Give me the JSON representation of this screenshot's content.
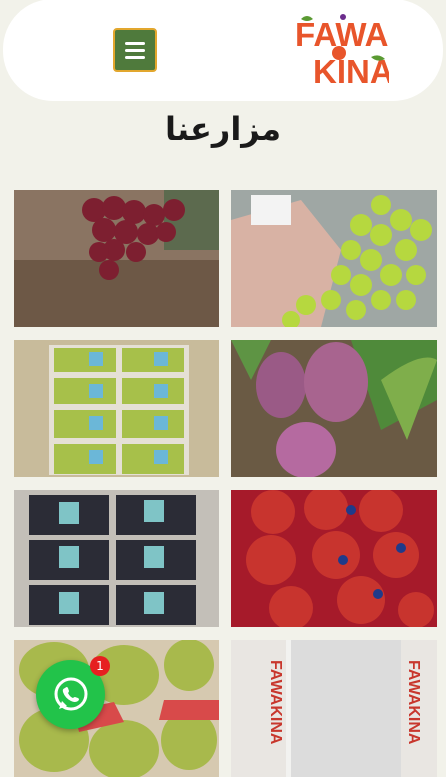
{
  "header": {
    "logo_text_line1": "FAWA",
    "logo_text_line2": "KINA",
    "menu_icon": "hamburger-menu-icon"
  },
  "page": {
    "title": "مزارعنا"
  },
  "gallery": {
    "items": [
      {
        "subject": "red-grapes"
      },
      {
        "subject": "green-grapes-in-hand"
      },
      {
        "subject": "packed-green-grapes"
      },
      {
        "subject": "mangoes-on-tree"
      },
      {
        "subject": "packed-black-grapes"
      },
      {
        "subject": "pomegranates-in-box"
      },
      {
        "subject": "mangoes-in-box"
      },
      {
        "subject": "fawakina-boxes"
      }
    ],
    "box_brand": "FAWAKINA"
  },
  "whatsapp": {
    "icon": "whatsapp-icon",
    "badge_count": "1"
  },
  "colors": {
    "background": "#f2f2ea",
    "menu_button": "#4f7a3c",
    "menu_border": "#e2a72e",
    "logo_orange": "#e8552b",
    "whatsapp_green": "#22c34a",
    "badge_red": "#e62020"
  }
}
